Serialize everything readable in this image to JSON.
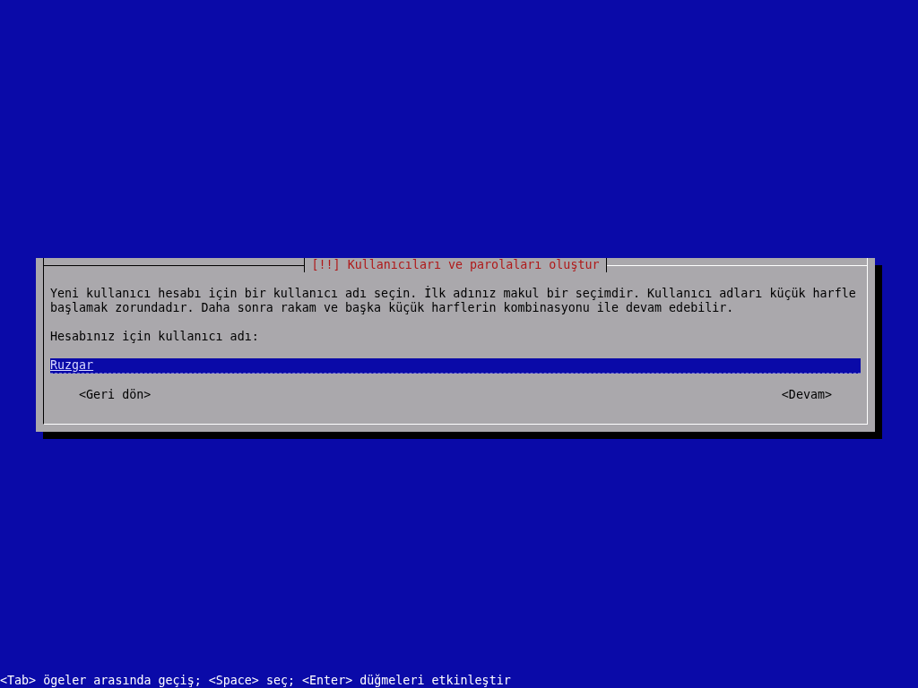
{
  "dialog": {
    "title": "[!!] Kullanıcıları ve parolaları oluştur",
    "message": "Yeni kullanıcı hesabı için bir kullanıcı adı seçin. İlk adınız makul bir seçimdir. Kullanıcı adları küçük harfle başlamak zorundadır. Daha sonra rakam ve başka küçük harflerin kombinasyonu ile devam edebilir.",
    "prompt": "Hesabınız için kullanıcı adı:",
    "field": {
      "value": "Ruzgar"
    },
    "buttons": [
      {
        "label": "<Geri dön>"
      },
      {
        "label": "<Devam>"
      }
    ]
  },
  "status_bar": "<Tab> ögeler arasında geçiş; <Space> seç; <Enter> düğmeleri etkinleştir"
}
